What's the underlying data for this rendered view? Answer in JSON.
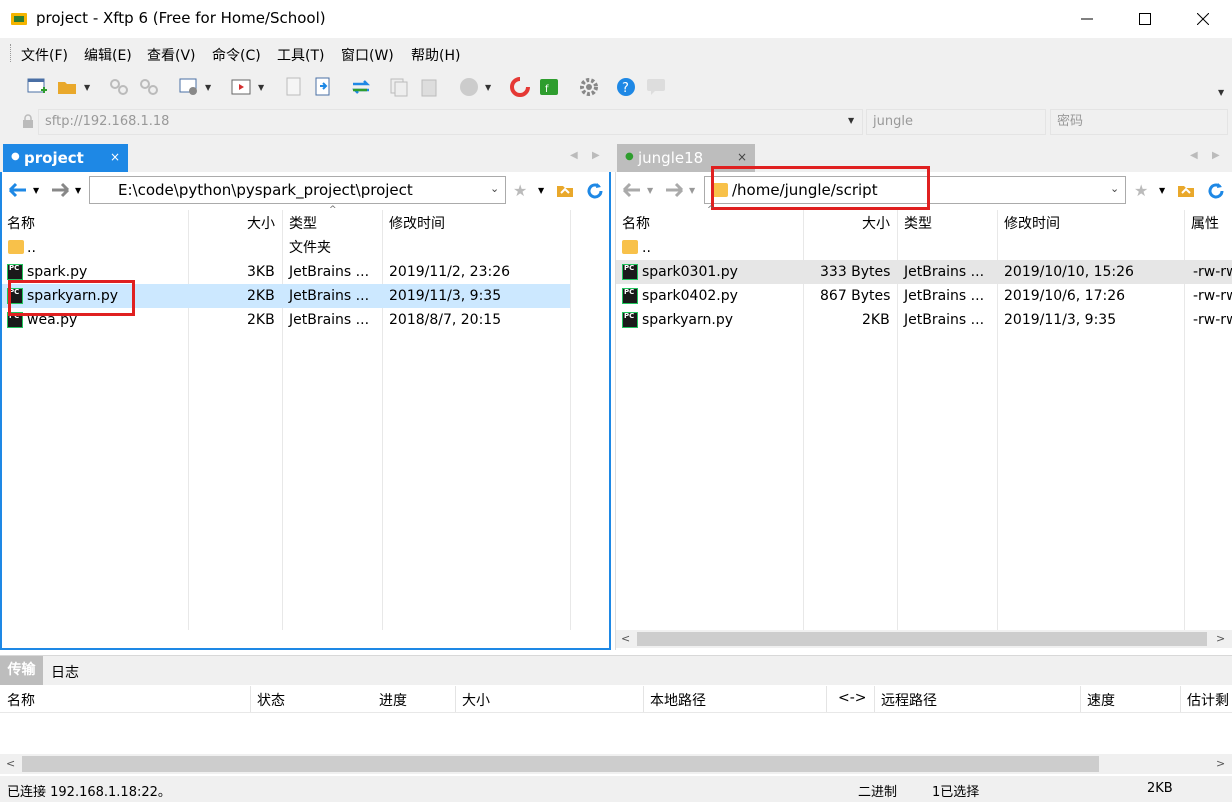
{
  "window": {
    "title": "project - Xftp 6 (Free for Home/School)"
  },
  "menu": [
    "文件(F)",
    "编辑(E)",
    "查看(V)",
    "命令(C)",
    "工具(T)",
    "窗口(W)",
    "帮助(H)"
  ],
  "address": {
    "host": "sftp://192.168.1.18",
    "user": "jungle",
    "password": "密码"
  },
  "left": {
    "tab": "project",
    "path": "E:\\code\\python\\pyspark_project\\project",
    "columns": [
      "名称",
      "大小",
      "类型",
      "修改时间"
    ],
    "rows": [
      {
        "name": "..",
        "size": "",
        "type": "文件夹",
        "mtime": "",
        "icon": "folder-icon"
      },
      {
        "name": "spark.py",
        "size": "3KB",
        "type": "JetBrains ...",
        "mtime": "2019/11/2, 23:26",
        "icon": "pycharm-file-icon"
      },
      {
        "name": "sparkyarn.py",
        "size": "2KB",
        "type": "JetBrains ...",
        "mtime": "2019/11/3, 9:35",
        "icon": "pycharm-file-icon"
      },
      {
        "name": "wea.py",
        "size": "2KB",
        "type": "JetBrains ...",
        "mtime": "2018/8/7, 20:15",
        "icon": "pycharm-file-icon"
      }
    ]
  },
  "right": {
    "tab": "jungle18",
    "path": "/home/jungle/script",
    "columns": [
      "名称",
      "大小",
      "类型",
      "修改时间",
      "属性"
    ],
    "rows": [
      {
        "name": "..",
        "size": "",
        "type": "",
        "mtime": "",
        "attr": "",
        "icon": "folder-icon"
      },
      {
        "name": "spark0301.py",
        "size": "333 Bytes",
        "type": "JetBrains ...",
        "mtime": "2019/10/10, 15:26",
        "attr": "-rw-rw",
        "icon": "pycharm-file-icon"
      },
      {
        "name": "spark0402.py",
        "size": "867 Bytes",
        "type": "JetBrains ...",
        "mtime": "2019/10/6, 17:26",
        "attr": "-rw-rw",
        "icon": "pycharm-file-icon"
      },
      {
        "name": "sparkyarn.py",
        "size": "2KB",
        "type": "JetBrains ...",
        "mtime": "2019/11/3, 9:35",
        "attr": "-rw-rw",
        "icon": "pycharm-file-icon"
      }
    ]
  },
  "bottom": {
    "tabs": [
      "传输",
      "日志"
    ],
    "columns": [
      "名称",
      "状态",
      "进度",
      "大小",
      "本地路径",
      "<->",
      "远程路径",
      "速度",
      "估计剩"
    ]
  },
  "status": {
    "connection": "已连接 192.168.1.18:22。",
    "mode": "二进制",
    "selection": "1已选择",
    "size": "2KB"
  },
  "colors": {
    "accent": "#1e88e5",
    "highlight": "#e02020",
    "selected_row": "#cce8ff"
  }
}
